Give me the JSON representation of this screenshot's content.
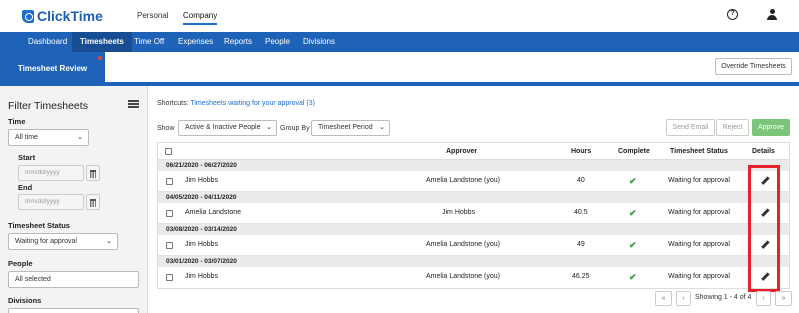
{
  "app": {
    "logo_text": "ClickTime",
    "top_nav": [
      {
        "label": "Personal"
      },
      {
        "label": "Company"
      }
    ],
    "help_icon_text": "?"
  },
  "nav": [
    "Dashboard",
    "Timesheets",
    "Time Off",
    "Expenses",
    "Reports",
    "People",
    "Divisions"
  ],
  "subbar": {
    "tab_label": "Timesheet Review",
    "override_label": "Override Timesheets"
  },
  "filter": {
    "title": "Filter Timesheets",
    "time_label": "Time",
    "time_value": "All time",
    "start_label": "Start",
    "start_placeholder": "mm/dd/yyyy",
    "end_label": "End",
    "end_placeholder": "mm/dd/yyyy",
    "status_label": "Timesheet Status",
    "status_value": "Waiting for approval",
    "people_label": "People",
    "people_value": "All selected",
    "divisions_label": "Divisions"
  },
  "main": {
    "shortcuts_label": "Shortcuts:",
    "shortcuts_link": "Timesheets waiting for your approval (3)",
    "show_label": "Show",
    "show_value": "Active & Inactive People",
    "groupby_label": "Group By",
    "groupby_value": "Timesheet Period",
    "send_email_label": "Send Email",
    "reject_label": "Reject",
    "approve_label": "Approve"
  },
  "table": {
    "columns": [
      "Approver",
      "Hours",
      "Complete",
      "Timesheet Status",
      "Details"
    ],
    "groups": [
      {
        "period": "06/21/2020 - 06/27/2020",
        "name": "Jim Hobbs",
        "approver": "Amelia Landstone (you)",
        "hours": "40",
        "complete": "✔",
        "status": "Waiting for approval"
      },
      {
        "period": "04/05/2020 - 04/11/2020",
        "name": "Amelia Landstone",
        "approver": "Jim Hobbs",
        "hours": "40.5",
        "complete": "✔",
        "status": "Waiting for approval"
      },
      {
        "period": "03/08/2020 - 03/14/2020",
        "name": "Jim Hobbs",
        "approver": "Amelia Landstone (you)",
        "hours": "49",
        "complete": "✔",
        "status": "Waiting for approval"
      },
      {
        "period": "03/01/2020 - 03/07/2020",
        "name": "Jim Hobbs",
        "approver": "Amelia Landstone (you)",
        "hours": "46.25",
        "complete": "✔",
        "status": "Waiting for approval"
      }
    ]
  },
  "pagination": {
    "first": "«",
    "prev": "‹",
    "info": "Showing 1 - 4 of 4",
    "next": "›",
    "last": "»"
  },
  "colors": {
    "brand_blue": "#1e63b8",
    "approve_green": "#7cc47a",
    "highlight_red": "#e6212a"
  }
}
